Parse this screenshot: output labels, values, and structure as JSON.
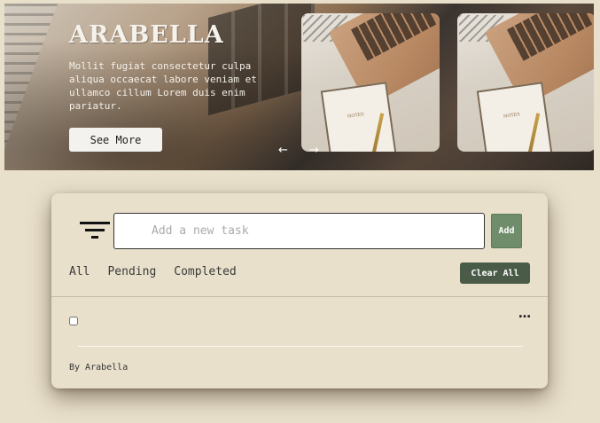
{
  "hero": {
    "title": "ARABELLA",
    "description": "Mollit fugiat consectetur culpa aliqua occaecat labore veniam et ullamco cillum Lorem duis enim pariatur.",
    "see_more_label": "See More",
    "prev_icon": "arrow-left-icon",
    "next_icon": "arrow-right-icon",
    "prev_glyph": "←",
    "next_glyph": "→",
    "thumbnail_notebook_label": "NOTES"
  },
  "todo": {
    "input_placeholder": "Add a new task",
    "input_value": "",
    "add_label": "Add",
    "tabs": [
      "All",
      "Pending",
      "Completed"
    ],
    "clear_all_label": "Clear All",
    "more_glyph": "…",
    "footer": "By Arabella"
  },
  "colors": {
    "background": "#e9e0cb",
    "add_button": "#6f8d6b",
    "clear_button": "#4a5c47"
  }
}
